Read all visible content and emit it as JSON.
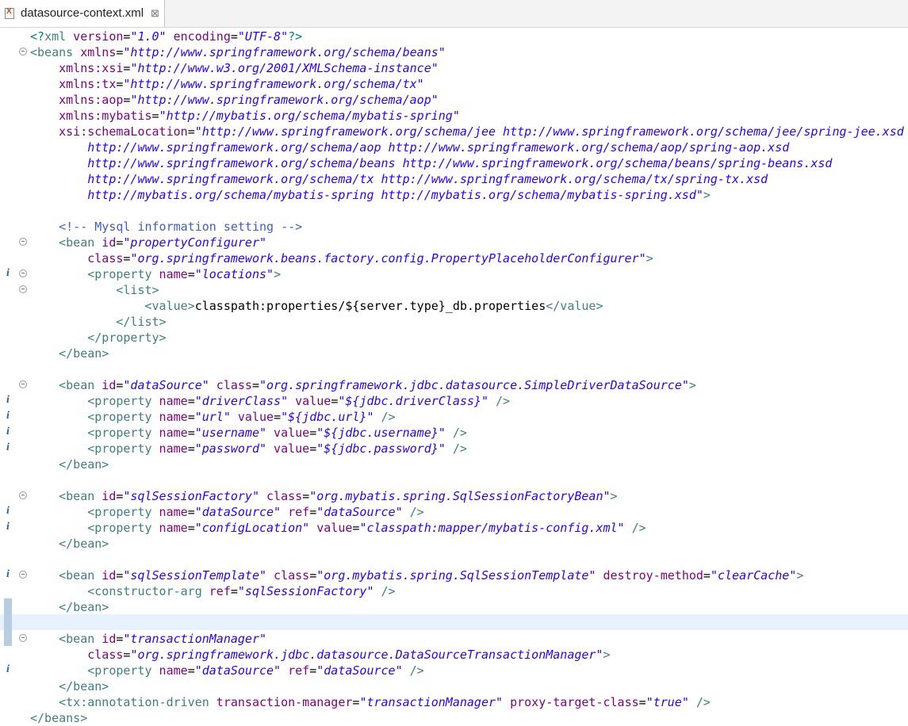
{
  "tab": {
    "file_name": "datasource-context.xml",
    "close_glyph": "⊠",
    "icon": "xml-file-icon"
  },
  "colors": {
    "tag": "#3f7f7f",
    "attribute": "#7f007f",
    "value": "#2a00ff",
    "comment": "#3f5fbf",
    "text": "#000000",
    "current_line": "#e8f2fe"
  },
  "lines": [
    {
      "ind": 0,
      "fold": false,
      "info": false,
      "t": [
        [
          "p",
          "<?"
        ],
        [
          "t",
          "xml"
        ],
        [
          "a",
          " version"
        ],
        [
          "",
          "="
        ],
        [
          "v",
          "\"1.0\""
        ],
        [
          "a",
          " encoding"
        ],
        [
          "",
          "="
        ],
        [
          "v",
          "\"UTF-8\""
        ],
        [
          "p",
          "?>"
        ]
      ]
    },
    {
      "ind": 0,
      "fold": true,
      "info": false,
      "t": [
        [
          "t",
          "<beans"
        ],
        [
          "a",
          " xmlns"
        ],
        [
          "",
          "="
        ],
        [
          "v",
          "\"http://www.springframework.org/schema/beans\""
        ]
      ]
    },
    {
      "ind": 4,
      "fold": false,
      "info": false,
      "t": [
        [
          "a",
          "xmlns:xsi"
        ],
        [
          "",
          "="
        ],
        [
          "v",
          "\"http://www.w3.org/2001/XMLSchema-instance\""
        ]
      ]
    },
    {
      "ind": 4,
      "fold": false,
      "info": false,
      "t": [
        [
          "a",
          "xmlns:tx"
        ],
        [
          "",
          "="
        ],
        [
          "v",
          "\"http://www.springframework.org/schema/tx\""
        ]
      ]
    },
    {
      "ind": 4,
      "fold": false,
      "info": false,
      "t": [
        [
          "a",
          "xmlns:aop"
        ],
        [
          "",
          "="
        ],
        [
          "v",
          "\"http://www.springframework.org/schema/aop\""
        ]
      ]
    },
    {
      "ind": 4,
      "fold": false,
      "info": false,
      "t": [
        [
          "a",
          "xmlns:mybatis"
        ],
        [
          "",
          "="
        ],
        [
          "v",
          "\"http://mybatis.org/schema/mybatis-spring\""
        ]
      ]
    },
    {
      "ind": 4,
      "fold": false,
      "info": false,
      "t": [
        [
          "a",
          "xsi:schemaLocation"
        ],
        [
          "",
          "="
        ],
        [
          "v",
          "\"http://www.springframework.org/schema/jee http://www.springframework.org/schema/jee/spring-jee.xsd"
        ]
      ]
    },
    {
      "ind": 8,
      "fold": false,
      "info": false,
      "t": [
        [
          "v",
          "http://www.springframework.org/schema/aop http://www.springframework.org/schema/aop/spring-aop.xsd"
        ]
      ]
    },
    {
      "ind": 8,
      "fold": false,
      "info": false,
      "t": [
        [
          "v",
          "http://www.springframework.org/schema/beans http://www.springframework.org/schema/beans/spring-beans.xsd"
        ]
      ]
    },
    {
      "ind": 8,
      "fold": false,
      "info": false,
      "t": [
        [
          "v",
          "http://www.springframework.org/schema/tx http://www.springframework.org/schema/tx/spring-tx.xsd"
        ]
      ]
    },
    {
      "ind": 8,
      "fold": false,
      "info": false,
      "t": [
        [
          "v",
          "http://mybatis.org/schema/mybatis-spring http://mybatis.org/schema/mybatis-spring.xsd\""
        ],
        [
          "t",
          ">"
        ]
      ]
    },
    {
      "ind": 0,
      "fold": false,
      "info": false,
      "t": []
    },
    {
      "ind": 4,
      "fold": false,
      "info": false,
      "t": [
        [
          "c",
          "<!-- Mysql information setting -->"
        ]
      ]
    },
    {
      "ind": 4,
      "fold": true,
      "info": false,
      "t": [
        [
          "t",
          "<bean"
        ],
        [
          "a",
          " id"
        ],
        [
          "",
          "="
        ],
        [
          "v",
          "\"propertyConfigurer\""
        ]
      ]
    },
    {
      "ind": 8,
      "fold": false,
      "info": false,
      "t": [
        [
          "a",
          "class"
        ],
        [
          "",
          "="
        ],
        [
          "v",
          "\"org.springframework.beans.factory.config.PropertyPlaceholderConfigurer\""
        ],
        [
          "t",
          ">"
        ]
      ]
    },
    {
      "ind": 8,
      "fold": true,
      "info": true,
      "t": [
        [
          "t",
          "<property"
        ],
        [
          "a",
          " name"
        ],
        [
          "",
          "="
        ],
        [
          "v",
          "\"locations\""
        ],
        [
          "t",
          ">"
        ]
      ]
    },
    {
      "ind": 12,
      "fold": true,
      "info": false,
      "t": [
        [
          "t",
          "<list>"
        ]
      ]
    },
    {
      "ind": 16,
      "fold": false,
      "info": false,
      "t": [
        [
          "t",
          "<value>"
        ],
        [
          "",
          "classpath:properties/${server.type}_db.properties"
        ],
        [
          "t",
          "</value>"
        ]
      ]
    },
    {
      "ind": 12,
      "fold": false,
      "info": false,
      "t": [
        [
          "t",
          "</list>"
        ]
      ]
    },
    {
      "ind": 8,
      "fold": false,
      "info": false,
      "t": [
        [
          "t",
          "</property>"
        ]
      ]
    },
    {
      "ind": 4,
      "fold": false,
      "info": false,
      "t": [
        [
          "t",
          "</bean>"
        ]
      ]
    },
    {
      "ind": 0,
      "fold": false,
      "info": false,
      "t": []
    },
    {
      "ind": 4,
      "fold": true,
      "info": false,
      "t": [
        [
          "t",
          "<bean"
        ],
        [
          "a",
          " id"
        ],
        [
          "",
          "="
        ],
        [
          "v",
          "\"dataSource\""
        ],
        [
          "a",
          " class"
        ],
        [
          "",
          "="
        ],
        [
          "v",
          "\"org.springframework.jdbc.datasource.SimpleDriverDataSource\""
        ],
        [
          "t",
          ">"
        ]
      ]
    },
    {
      "ind": 8,
      "fold": false,
      "info": true,
      "t": [
        [
          "t",
          "<property"
        ],
        [
          "a",
          " name"
        ],
        [
          "",
          "="
        ],
        [
          "v",
          "\"driverClass\""
        ],
        [
          "a",
          " value"
        ],
        [
          "",
          "="
        ],
        [
          "v",
          "\"${jdbc.driverClass}\""
        ],
        [
          "t",
          " />"
        ]
      ]
    },
    {
      "ind": 8,
      "fold": false,
      "info": true,
      "t": [
        [
          "t",
          "<property"
        ],
        [
          "a",
          " name"
        ],
        [
          "",
          "="
        ],
        [
          "v",
          "\"url\""
        ],
        [
          "a",
          " value"
        ],
        [
          "",
          "="
        ],
        [
          "v",
          "\"${jdbc.url}\""
        ],
        [
          "t",
          " />"
        ]
      ]
    },
    {
      "ind": 8,
      "fold": false,
      "info": true,
      "t": [
        [
          "t",
          "<property"
        ],
        [
          "a",
          " name"
        ],
        [
          "",
          "="
        ],
        [
          "v",
          "\"username\""
        ],
        [
          "a",
          " value"
        ],
        [
          "",
          "="
        ],
        [
          "v",
          "\"${jdbc.username}\""
        ],
        [
          "t",
          " />"
        ]
      ]
    },
    {
      "ind": 8,
      "fold": false,
      "info": true,
      "t": [
        [
          "t",
          "<property"
        ],
        [
          "a",
          " name"
        ],
        [
          "",
          "="
        ],
        [
          "v",
          "\"password\""
        ],
        [
          "a",
          " value"
        ],
        [
          "",
          "="
        ],
        [
          "v",
          "\"${jdbc.password}\""
        ],
        [
          "t",
          " />"
        ]
      ]
    },
    {
      "ind": 4,
      "fold": false,
      "info": false,
      "t": [
        [
          "t",
          "</bean>"
        ]
      ]
    },
    {
      "ind": 0,
      "fold": false,
      "info": false,
      "t": []
    },
    {
      "ind": 4,
      "fold": true,
      "info": false,
      "t": [
        [
          "t",
          "<bean"
        ],
        [
          "a",
          " id"
        ],
        [
          "",
          "="
        ],
        [
          "v",
          "\"sqlSessionFactory\""
        ],
        [
          "a",
          " class"
        ],
        [
          "",
          "="
        ],
        [
          "v",
          "\"org.mybatis.spring.SqlSessionFactoryBean\""
        ],
        [
          "t",
          ">"
        ]
      ]
    },
    {
      "ind": 8,
      "fold": false,
      "info": true,
      "t": [
        [
          "t",
          "<property"
        ],
        [
          "a",
          " name"
        ],
        [
          "",
          "="
        ],
        [
          "v",
          "\"dataSource\""
        ],
        [
          "a",
          " ref"
        ],
        [
          "",
          "="
        ],
        [
          "v",
          "\"dataSource\""
        ],
        [
          "t",
          " />"
        ]
      ]
    },
    {
      "ind": 8,
      "fold": false,
      "info": true,
      "t": [
        [
          "t",
          "<property"
        ],
        [
          "a",
          " name"
        ],
        [
          "",
          "="
        ],
        [
          "v",
          "\"configLocation\""
        ],
        [
          "a",
          " value"
        ],
        [
          "",
          "="
        ],
        [
          "v",
          "\"classpath:mapper/mybatis-config.xml\""
        ],
        [
          "t",
          " />"
        ]
      ]
    },
    {
      "ind": 4,
      "fold": false,
      "info": false,
      "t": [
        [
          "t",
          "</bean>"
        ]
      ]
    },
    {
      "ind": 0,
      "fold": false,
      "info": false,
      "t": []
    },
    {
      "ind": 4,
      "fold": true,
      "info": true,
      "t": [
        [
          "t",
          "<bean"
        ],
        [
          "a",
          " id"
        ],
        [
          "",
          "="
        ],
        [
          "v",
          "\"sqlSessionTemplate\""
        ],
        [
          "a",
          " class"
        ],
        [
          "",
          "="
        ],
        [
          "v",
          "\"org.mybatis.spring.SqlSessionTemplate\""
        ],
        [
          "a",
          " destroy-method"
        ],
        [
          "",
          "="
        ],
        [
          "v",
          "\"clearCache\""
        ],
        [
          "t",
          ">"
        ]
      ]
    },
    {
      "ind": 8,
      "fold": false,
      "info": false,
      "t": [
        [
          "t",
          "<constructor-arg"
        ],
        [
          "a",
          " ref"
        ],
        [
          "",
          "="
        ],
        [
          "v",
          "\"sqlSessionFactory\""
        ],
        [
          "t",
          " />"
        ]
      ]
    },
    {
      "ind": 4,
      "fold": false,
      "info": false,
      "change": true,
      "t": [
        [
          "t",
          "</bean>"
        ]
      ]
    },
    {
      "ind": 0,
      "fold": false,
      "info": false,
      "change": true,
      "current": true,
      "t": []
    },
    {
      "ind": 4,
      "fold": true,
      "info": false,
      "change": true,
      "t": [
        [
          "t",
          "<bean"
        ],
        [
          "a",
          " id"
        ],
        [
          "",
          "="
        ],
        [
          "v",
          "\"transactionManager\""
        ]
      ]
    },
    {
      "ind": 8,
      "fold": false,
      "info": false,
      "t": [
        [
          "a",
          "class"
        ],
        [
          "",
          "="
        ],
        [
          "v",
          "\"org.springframework.jdbc.datasource.DataSourceTransactionManager\""
        ],
        [
          "t",
          ">"
        ]
      ]
    },
    {
      "ind": 8,
      "fold": false,
      "info": true,
      "t": [
        [
          "t",
          "<property"
        ],
        [
          "a",
          " name"
        ],
        [
          "",
          "="
        ],
        [
          "v",
          "\"dataSource\""
        ],
        [
          "a",
          " ref"
        ],
        [
          "",
          "="
        ],
        [
          "v",
          "\"dataSource\""
        ],
        [
          "t",
          " />"
        ]
      ]
    },
    {
      "ind": 4,
      "fold": false,
      "info": false,
      "t": [
        [
          "t",
          "</bean>"
        ]
      ]
    },
    {
      "ind": 4,
      "fold": false,
      "info": false,
      "t": [
        [
          "t",
          "<tx:annotation-driven"
        ],
        [
          "a",
          " transaction-manager"
        ],
        [
          "",
          "="
        ],
        [
          "v",
          "\"transactionManager\""
        ],
        [
          "a",
          " proxy-target-class"
        ],
        [
          "",
          "="
        ],
        [
          "v",
          "\"true\""
        ],
        [
          "t",
          " />"
        ]
      ]
    },
    {
      "ind": 0,
      "fold": false,
      "info": false,
      "t": [
        [
          "t",
          "</beans>"
        ]
      ]
    }
  ],
  "info_glyph": "i"
}
